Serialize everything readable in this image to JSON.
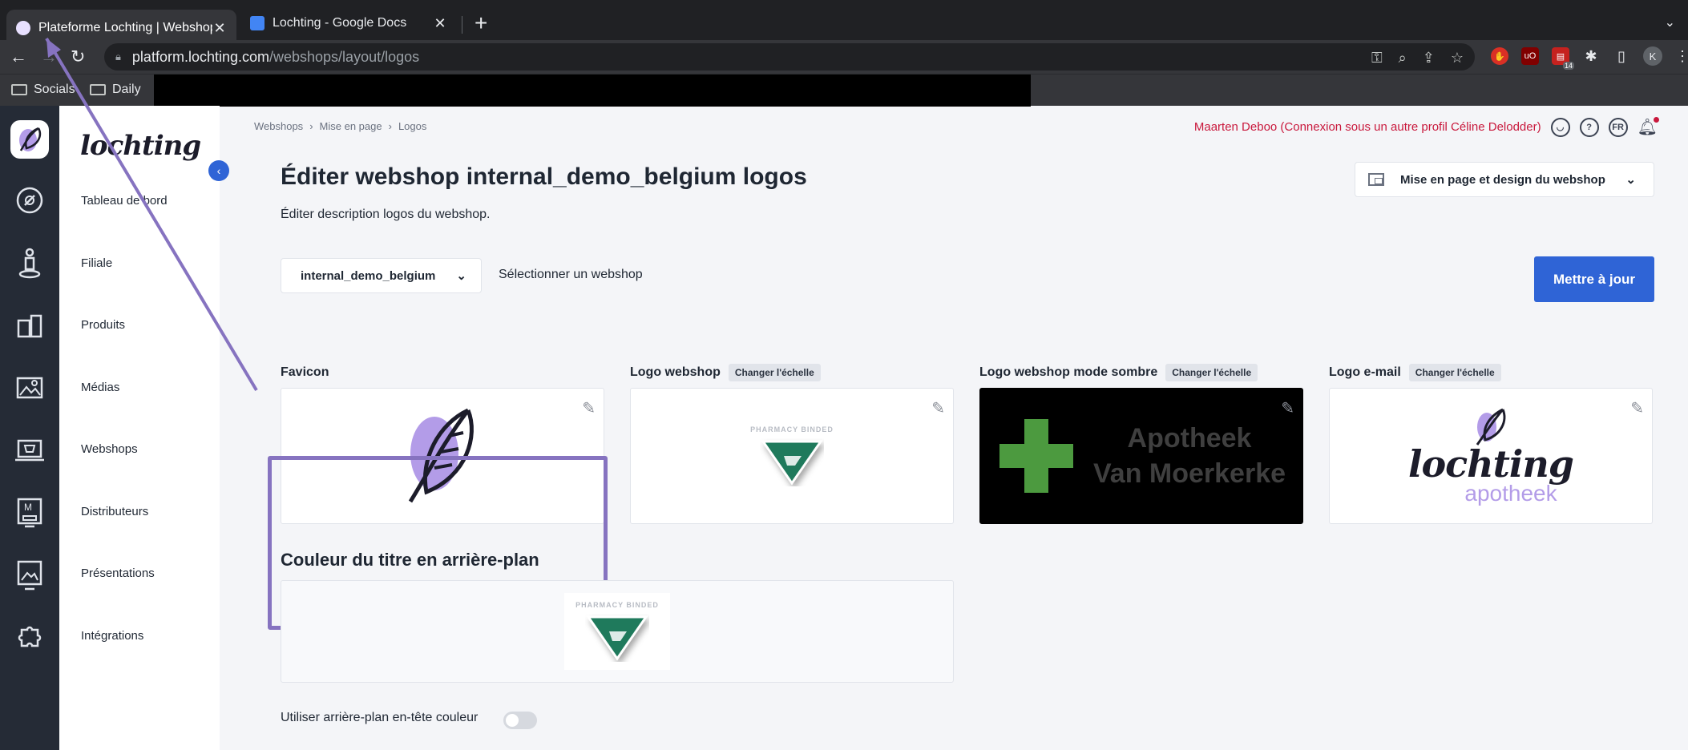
{
  "browser": {
    "tabs": [
      {
        "title": "Plateforme Lochting | Webshop",
        "active": true
      },
      {
        "title": "Lochting - Google Docs",
        "active": false
      }
    ],
    "url_host": "platform.lochting.com",
    "url_path": "/webshops/layout/logos",
    "bookmarks": [
      "Socials",
      "Daily"
    ],
    "extension_badge": "14",
    "profile_initial": "K"
  },
  "sidebar": {
    "brand": "lochting",
    "items": [
      {
        "label": "Tableau de bord",
        "icon": "dashboard-icon"
      },
      {
        "label": "Filiale",
        "icon": "branch-icon"
      },
      {
        "label": "Produits",
        "icon": "products-icon"
      },
      {
        "label": "Médias",
        "icon": "media-icon"
      },
      {
        "label": "Webshops",
        "icon": "webshop-icon"
      },
      {
        "label": "Distributeurs",
        "icon": "distributor-icon"
      },
      {
        "label": "Présentations",
        "icon": "presentation-icon"
      },
      {
        "label": "Intégrations",
        "icon": "integrations-icon"
      }
    ]
  },
  "header": {
    "breadcrumbs": [
      "Webshops",
      "Mise en page",
      "Logos"
    ],
    "user_text": "Maarten Deboo (Connexion sous un autre profil Céline Delodder)",
    "language": "FR"
  },
  "page": {
    "title": "Éditer webshop internal_demo_belgium logos",
    "subtitle": "Éditer description logos du webshop.",
    "layout_dropdown": "Mise en page et design du webshop",
    "webshop_select_value": "internal_demo_belgium",
    "webshop_select_label": "Sélectionner un webshop",
    "update_button": "Mettre à jour"
  },
  "logos": {
    "scale_label": "Changer l'échelle",
    "pharmacy_tag": "PHARMACY BINDED",
    "items": [
      {
        "title": "Favicon"
      },
      {
        "title": "Logo webshop"
      },
      {
        "title": "Logo webshop mode sombre",
        "logo_text_1": "Apotheek",
        "logo_text_2": "Van Moerkerke"
      },
      {
        "title": "Logo e-mail",
        "logo_text_1": "lochting",
        "logo_text_2": "apotheek"
      }
    ]
  },
  "background": {
    "title": "Couleur du titre en arrière-plan",
    "toggle_label": "Utiliser arrière-plan en-tête couleur",
    "toggle_on": false
  },
  "colors": {
    "accent": "#2f64d6",
    "user_text": "#c9183c",
    "favicon_frame": "#8673c0",
    "rail_bg": "#252b36"
  }
}
